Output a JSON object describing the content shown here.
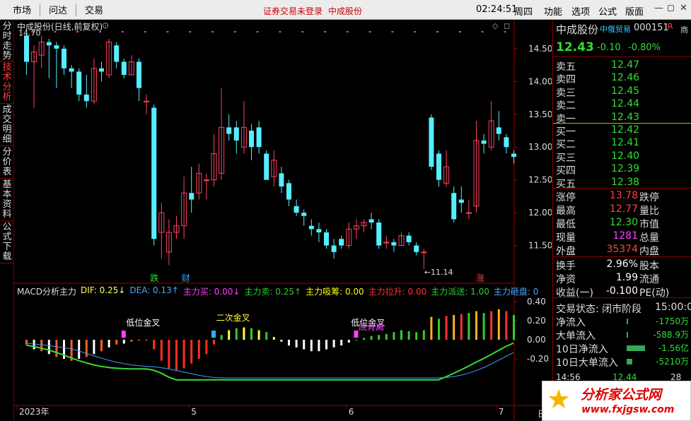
{
  "topbar": {
    "menu": [
      "市场",
      "问达",
      "交易"
    ],
    "notice": "证券交易未登录",
    "stock": "中成股份",
    "time": "02:24:51",
    "weekday": "周四",
    "right_menu": [
      "功能",
      "选项",
      "公式",
      "版面"
    ],
    "win_controls": [
      "—",
      "◻",
      "✕"
    ]
  },
  "left_tabs": [
    {
      "label": "分时走势",
      "active": false
    },
    {
      "label": "技术分析",
      "active": true
    },
    {
      "label": "成交明细",
      "active": false
    },
    {
      "label": "分价表",
      "active": false
    },
    {
      "label": "基本资料",
      "active": false
    },
    {
      "label": "公式下载",
      "active": false
    }
  ],
  "chart": {
    "title": "中成股份(日线,前复权)",
    "max_label": "14.70",
    "min_label": "11.14",
    "price_axis": [
      "14.50",
      "14.00",
      "13.50",
      "13.00",
      "12.50",
      "12.00",
      "11.50"
    ],
    "events": [
      {
        "label": "跌"
      },
      {
        "label": "财"
      },
      {
        "label": "涨"
      }
    ],
    "ind_header": [
      {
        "text": "MACD分析主力",
        "color": "#dddddd"
      },
      {
        "text": "DIF: 0.25↓",
        "color": "#ffff66"
      },
      {
        "text": "DEA: 0.13↑",
        "color": "#4aa8ff"
      },
      {
        "text": "主力买: 0.00↓",
        "color": "#ff40ff"
      },
      {
        "text": "主力卖: 0.25↑",
        "color": "#33cc33"
      },
      {
        "text": "主力吸筹: 0.00",
        "color": "#ffff00"
      },
      {
        "text": "主力拉升: 0.00",
        "color": "#ff3333"
      },
      {
        "text": "主力派送: 1.00",
        "color": "#33cc33"
      },
      {
        "text": "主力砸盘: 0",
        "color": "#4aa8ff"
      }
    ],
    "ind_axis": [
      "0.40",
      "0.20",
      "0.00",
      "-0.20"
    ],
    "annotations": [
      "低位金叉",
      "二次金叉",
      "低位金叉",
      "底背离"
    ],
    "x_axis": [
      "2023年",
      "5",
      "6",
      "7"
    ],
    "period": "日线",
    "chart_data": {
      "type": "candlestick",
      "ylim": [
        11.0,
        14.8
      ],
      "candles": [
        [
          14.7,
          14.3,
          14.75,
          14.1
        ],
        [
          14.3,
          14.45,
          14.55,
          13.6
        ],
        [
          14.4,
          14.6,
          14.7,
          14.2
        ],
        [
          14.6,
          14.55,
          14.65,
          14.05
        ],
        [
          14.55,
          14.5,
          14.6,
          13.9
        ],
        [
          14.5,
          14.2,
          14.55,
          14.1
        ],
        [
          14.2,
          14.15,
          14.25,
          13.9
        ],
        [
          14.15,
          13.8,
          14.2,
          13.7
        ],
        [
          13.8,
          13.7,
          14.1,
          13.6
        ],
        [
          13.7,
          14.2,
          14.35,
          13.65
        ],
        [
          14.2,
          14.15,
          14.3,
          14.0
        ],
        [
          14.1,
          14.6,
          14.65,
          14.05
        ],
        [
          14.55,
          14.3,
          14.6,
          14.2
        ],
        [
          14.3,
          14.1,
          14.35,
          14.05
        ],
        [
          14.1,
          14.3,
          14.4,
          14.1
        ],
        [
          14.3,
          13.9,
          14.35,
          13.7
        ],
        [
          13.7,
          13.7,
          13.8,
          13.5
        ],
        [
          13.6,
          11.6,
          13.65,
          11.5
        ],
        [
          11.7,
          12.0,
          12.15,
          11.3
        ],
        [
          11.4,
          11.7,
          11.9,
          11.2
        ],
        [
          11.7,
          11.8,
          11.95,
          11.6
        ],
        [
          11.8,
          12.3,
          12.55,
          11.6
        ],
        [
          12.3,
          12.2,
          12.7,
          12.0
        ],
        [
          12.3,
          12.6,
          12.75,
          12.2
        ],
        [
          12.5,
          12.5,
          12.6,
          12.2
        ],
        [
          12.5,
          12.9,
          13.2,
          12.4
        ],
        [
          12.6,
          13.3,
          13.9,
          12.5
        ],
        [
          13.3,
          13.2,
          13.5,
          13.1
        ],
        [
          13.3,
          13.1,
          13.4,
          12.9
        ],
        [
          13.0,
          13.3,
          13.7,
          12.9
        ],
        [
          13.25,
          13.0,
          13.35,
          12.8
        ],
        [
          13.3,
          13.0,
          13.4,
          12.9
        ],
        [
          12.9,
          12.5,
          12.95,
          12.5
        ],
        [
          12.55,
          12.8,
          12.95,
          12.4
        ],
        [
          12.6,
          12.4,
          12.7,
          12.3
        ],
        [
          12.45,
          12.2,
          12.5,
          12.1
        ],
        [
          12.1,
          12.0,
          12.2,
          11.95
        ],
        [
          12.0,
          11.95,
          12.05,
          11.8
        ],
        [
          11.8,
          11.75,
          11.9,
          11.65
        ],
        [
          11.75,
          11.7,
          11.85,
          11.55
        ],
        [
          11.7,
          11.5,
          11.75,
          11.45
        ],
        [
          11.5,
          11.4,
          11.6,
          11.3
        ],
        [
          11.6,
          11.5,
          11.65,
          11.45
        ],
        [
          11.5,
          11.75,
          11.85,
          11.45
        ],
        [
          11.75,
          11.8,
          11.9,
          11.6
        ],
        [
          11.8,
          11.85,
          11.9,
          11.7
        ],
        [
          11.9,
          11.85,
          12.0,
          11.75
        ],
        [
          11.85,
          11.5,
          11.9,
          11.45
        ],
        [
          11.55,
          11.55,
          11.65,
          11.45
        ],
        [
          11.55,
          11.5,
          11.6,
          11.4
        ],
        [
          11.5,
          11.65,
          11.7,
          11.5
        ],
        [
          11.65,
          11.55,
          11.7,
          11.5
        ],
        [
          11.5,
          11.4,
          11.55,
          11.35
        ],
        [
          11.4,
          11.4,
          11.45,
          11.14
        ],
        [
          13.45,
          12.7,
          13.5,
          12.65
        ],
        [
          12.9,
          12.5,
          12.95,
          12.4
        ],
        [
          12.45,
          12.7,
          12.95,
          12.4
        ],
        [
          12.3,
          11.9,
          12.4,
          11.85
        ],
        [
          12.2,
          12.15,
          12.4,
          12.0
        ],
        [
          12.0,
          12.0,
          12.2,
          11.9
        ],
        [
          12.1,
          13.1,
          13.4,
          12.0
        ],
        [
          13.1,
          13.05,
          13.2,
          12.9
        ],
        [
          13.0,
          13.4,
          13.7,
          12.95
        ],
        [
          13.3,
          13.2,
          13.55,
          13.1
        ],
        [
          13.15,
          13.0,
          13.2,
          12.9
        ],
        [
          12.9,
          12.85,
          12.95,
          12.75
        ]
      ],
      "macd_bars": [
        -0.05,
        -0.1,
        -0.12,
        -0.15,
        -0.18,
        -0.2,
        -0.22,
        -0.2,
        -0.18,
        -0.15,
        -0.12,
        -0.08,
        -0.05,
        -0.04,
        -0.02,
        0.0,
        0.0,
        -0.1,
        -0.22,
        -0.3,
        -0.32,
        -0.3,
        -0.25,
        -0.2,
        -0.15,
        -0.05,
        0.05,
        0.1,
        0.12,
        0.13,
        0.12,
        0.1,
        0.08,
        0.03,
        -0.02,
        -0.06,
        -0.08,
        -0.1,
        -0.12,
        -0.12,
        -0.1,
        -0.08,
        -0.06,
        -0.03,
        0.0,
        0.02,
        0.04,
        0.05,
        0.06,
        0.08,
        0.1,
        0.09,
        0.08,
        0.1,
        0.24,
        0.22,
        0.25,
        0.26,
        0.27,
        0.28,
        0.3,
        0.28,
        0.3,
        0.32,
        0.3,
        0.26
      ]
    }
  },
  "panel": {
    "name": "中成股份",
    "badge": "中俄贸易",
    "code": "000151",
    "flag": "R",
    "cut": "商",
    "last": "12.43",
    "chg": "-0.10",
    "pct": "-0.80%",
    "asks": [
      {
        "l": "卖五",
        "p": "12.47"
      },
      {
        "l": "卖四",
        "p": "12.46"
      },
      {
        "l": "卖三",
        "p": "12.45"
      },
      {
        "l": "卖二",
        "p": "12.44"
      },
      {
        "l": "卖一",
        "p": "12.43"
      }
    ],
    "bids": [
      {
        "l": "买一",
        "p": "12.42"
      },
      {
        "l": "买二",
        "p": "12.41"
      },
      {
        "l": "买三",
        "p": "12.40"
      },
      {
        "l": "买四",
        "p": "12.39"
      },
      {
        "l": "买五",
        "p": "12.38"
      }
    ],
    "stats": [
      {
        "l": "涨停",
        "v": "13.78",
        "c": "#ff4040",
        "r": "跌停"
      },
      {
        "l": "最高",
        "v": "12.77",
        "c": "#ff4040",
        "r": "量比"
      },
      {
        "l": "最低",
        "v": "12.30",
        "c": "#33dd33",
        "r": "市值"
      },
      {
        "l": "现量",
        "v": "1281",
        "c": "#ff40ff",
        "r": "总量"
      },
      {
        "l": "外盘",
        "v": "35374",
        "c": "#ff4040",
        "r": "内盘"
      }
    ],
    "stats2": [
      {
        "l": "换手",
        "v": "2.96%",
        "c": "#ffffff",
        "r": "股本"
      },
      {
        "l": "净资",
        "v": "1.99",
        "c": "#ffffff",
        "r": "流通"
      },
      {
        "l": "收益(一)",
        "v": "-0.100",
        "c": "#ffffff",
        "r": "PE(动)"
      }
    ],
    "trade_state": "交易状态: 闭市阶段",
    "trade_time": "15:00:0",
    "flows": [
      {
        "l": "净流入",
        "v": "-1750万"
      },
      {
        "l": "大单流入",
        "v": "-588.9万"
      },
      {
        "l": "10日净流入",
        "v": "-1.56亿"
      },
      {
        "l": "10日大单流入",
        "v": "-5210万"
      }
    ],
    "tick_time": "14:56",
    "tick_price": "12.44",
    "tick_vol": "28"
  },
  "logo": {
    "line1": "分析家公式网",
    "line2": "www.fxjgsw.com"
  }
}
